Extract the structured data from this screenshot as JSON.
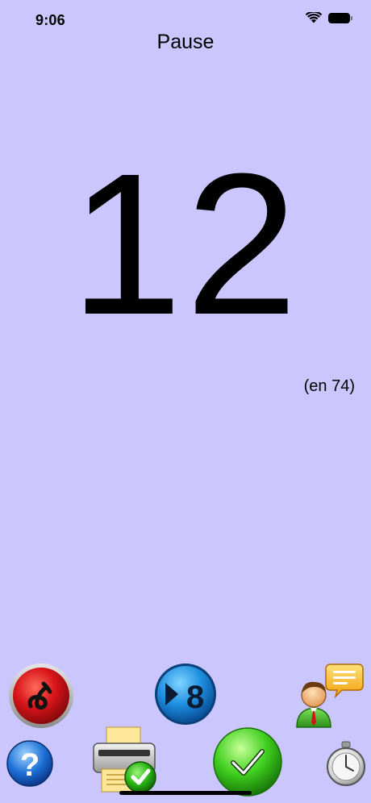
{
  "status_bar": {
    "time": "9:06",
    "icons": [
      "wifi-icon",
      "battery-icon"
    ]
  },
  "header": {
    "title": "Pause"
  },
  "counter": {
    "value": "12",
    "total_label": "(en 74)"
  },
  "toolbar": {
    "row1": [
      "undo-button",
      "skip-8-button",
      "contact-chat-button"
    ],
    "row2": [
      "help-button",
      "print-button",
      "confirm-button",
      "stopwatch-button"
    ]
  },
  "colors": {
    "background": "#cbc6fd",
    "undo_red": "#d8141a",
    "skip_blue": "#1e8fe0",
    "confirm_green": "#3fcf1e",
    "help_blue": "#1d6fd6"
  }
}
